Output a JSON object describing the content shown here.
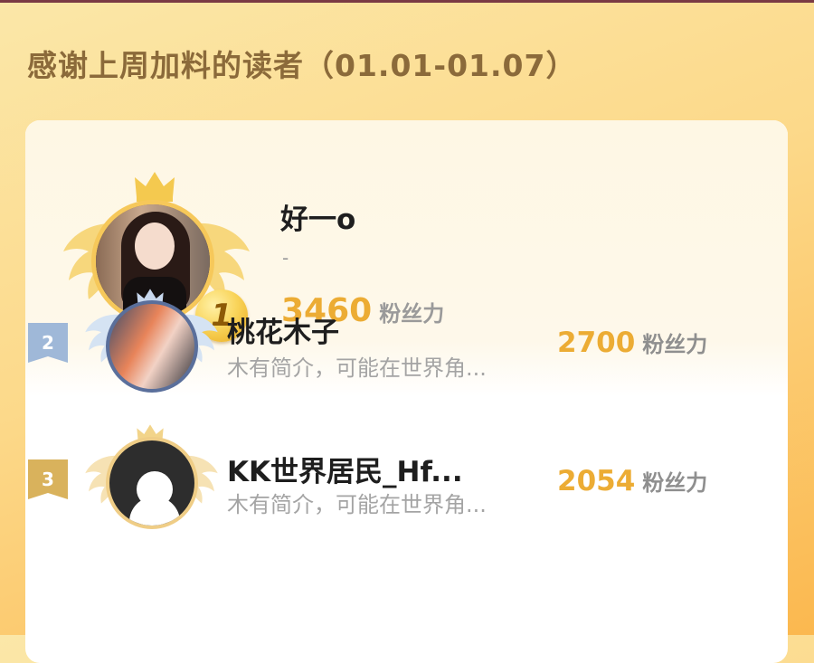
{
  "header": {
    "title": "感谢上周加料的读者（01.01-01.07）"
  },
  "leaderboard": [
    {
      "rank": "1",
      "name": "好一o",
      "bio": "-",
      "fans": "3460",
      "unit": "粉丝力",
      "rank_color": "#f6c85a"
    },
    {
      "rank": "2",
      "name": "桃花木子",
      "bio": "木有简介，可能在世界角...",
      "fans": "2700",
      "unit": "粉丝力",
      "rank_color": "#9fb8d8"
    },
    {
      "rank": "3",
      "name": "KK世界居民_Hf...",
      "bio": "木有简介，可能在世界角...",
      "fans": "2054",
      "unit": "粉丝力",
      "rank_color": "#d9b25c"
    }
  ],
  "colors": {
    "accent": "#ecac34",
    "title": "#8b6a3a"
  },
  "icons": {
    "crown": "crown-icon",
    "wings": "wing-icon",
    "medal": "medal-icon"
  }
}
